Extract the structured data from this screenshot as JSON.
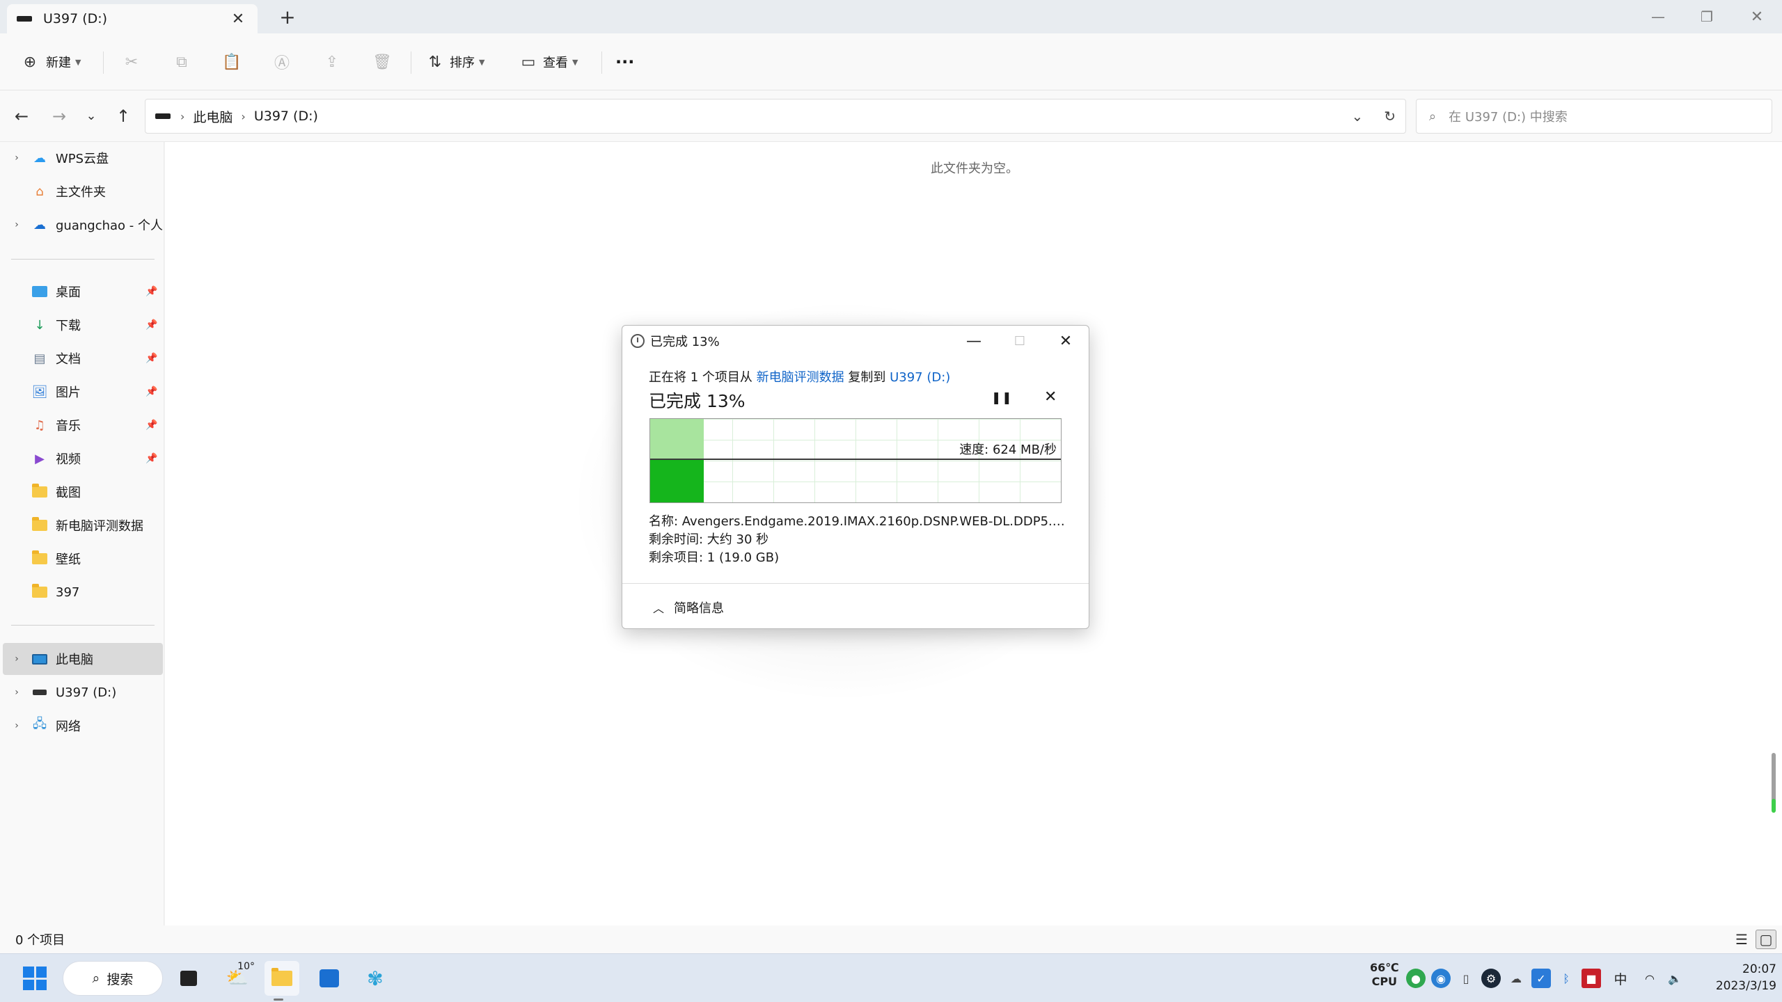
{
  "tab": {
    "title": "U397 (D:)",
    "close": "✕",
    "new": "+"
  },
  "window": {
    "minimize": "—",
    "restore": "❐",
    "close": "✕"
  },
  "toolbar": {
    "new_label": "新建",
    "sort_label": "排序",
    "view_label": "查看",
    "more": "···"
  },
  "address": {
    "crumbs": [
      "此电脑",
      "U397 (D:)"
    ],
    "search_placeholder": "在 U397 (D:) 中搜索"
  },
  "sidebar": {
    "items": [
      {
        "label": "WPS云盘"
      },
      {
        "label": "主文件夹"
      },
      {
        "label": "guangchao - 个人"
      },
      {
        "label": "桌面"
      },
      {
        "label": "下载"
      },
      {
        "label": "文档"
      },
      {
        "label": "图片"
      },
      {
        "label": "音乐"
      },
      {
        "label": "视频"
      },
      {
        "label": "截图"
      },
      {
        "label": "新电脑评测数据"
      },
      {
        "label": "壁纸"
      },
      {
        "label": "397"
      },
      {
        "label": "此电脑"
      },
      {
        "label": "U397 (D:)"
      },
      {
        "label": "网络"
      }
    ]
  },
  "content": {
    "empty": "此文件夹为空。"
  },
  "status": {
    "count": "0 个项目"
  },
  "dialog": {
    "title": "已完成 13%",
    "line_prefix": "正在将 1 个项目从 ",
    "source": "新电脑评测数据",
    "line_mid": " 复制到 ",
    "dest": "U397 (D:)",
    "percent_label": "已完成 13%",
    "progress": 0.13,
    "speed": "速度: 624 MB/秒",
    "name_row": "名称: Avengers.Endgame.2019.IMAX.2160p.DSNP.WEB-DL.DDP5.1....",
    "time_row": "剩余时间: 大约 30 秒",
    "items_row": "剩余项目: 1 (19.0 GB)",
    "less_label": "简略信息"
  },
  "taskbar": {
    "search_label": "搜索",
    "weather_temp": "10°",
    "cpu_temp": "66℃",
    "cpu_label": "CPU",
    "ime": "中",
    "time": "20:07",
    "date": "2023/3/19"
  },
  "colors": {
    "accent": "#1064c8",
    "progress_fill": "#15b51c",
    "progress_light": "#a8e49e"
  }
}
